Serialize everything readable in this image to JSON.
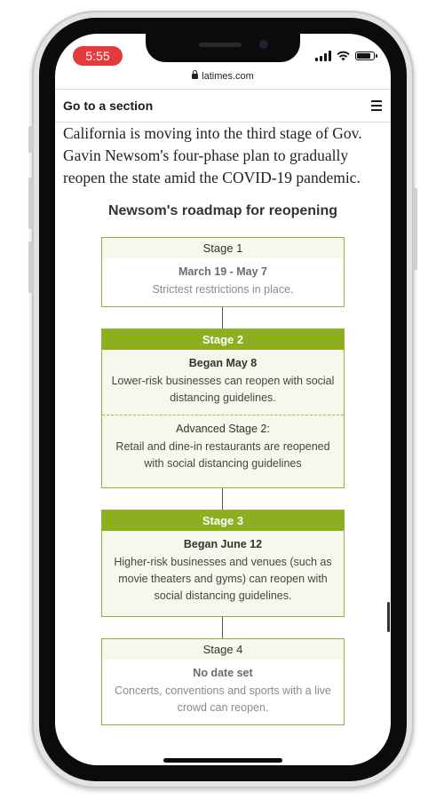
{
  "status_bar": {
    "time": "5:55"
  },
  "browser": {
    "url": "latimes.com"
  },
  "nav": {
    "label": "Go to a section"
  },
  "article": {
    "intro": "California is moving into the third stage of Gov. Gavin Newsom's four-phase plan to gradually reopen the state amid the COVID-19 pandemic."
  },
  "roadmap": {
    "title": "Newsom's roadmap for reopening",
    "stages": [
      {
        "label": "Stage 1",
        "date": "March 19 - May 7",
        "description": "Strictest restrictions in place."
      },
      {
        "label": "Stage 2",
        "date": "Began May 8",
        "description": "Lower-risk businesses can reopen with social distancing guidelines.",
        "sub_label": "Advanced Stage 2:",
        "sub_description": "Retail and dine-in restaurants are reopened with social distancing guidelines"
      },
      {
        "label": "Stage 3",
        "date": "Began June 12",
        "description": "Higher-risk businesses and venues (such as movie theaters and gyms) can reopen with social distancing guidelines."
      },
      {
        "label": "Stage 4",
        "date": "No date set",
        "description": "Concerts, conventions and sports with a live crowd can reopen."
      }
    ]
  },
  "colors": {
    "accent_green": "#8cae1f",
    "time_pill_red": "#e33b3b"
  }
}
